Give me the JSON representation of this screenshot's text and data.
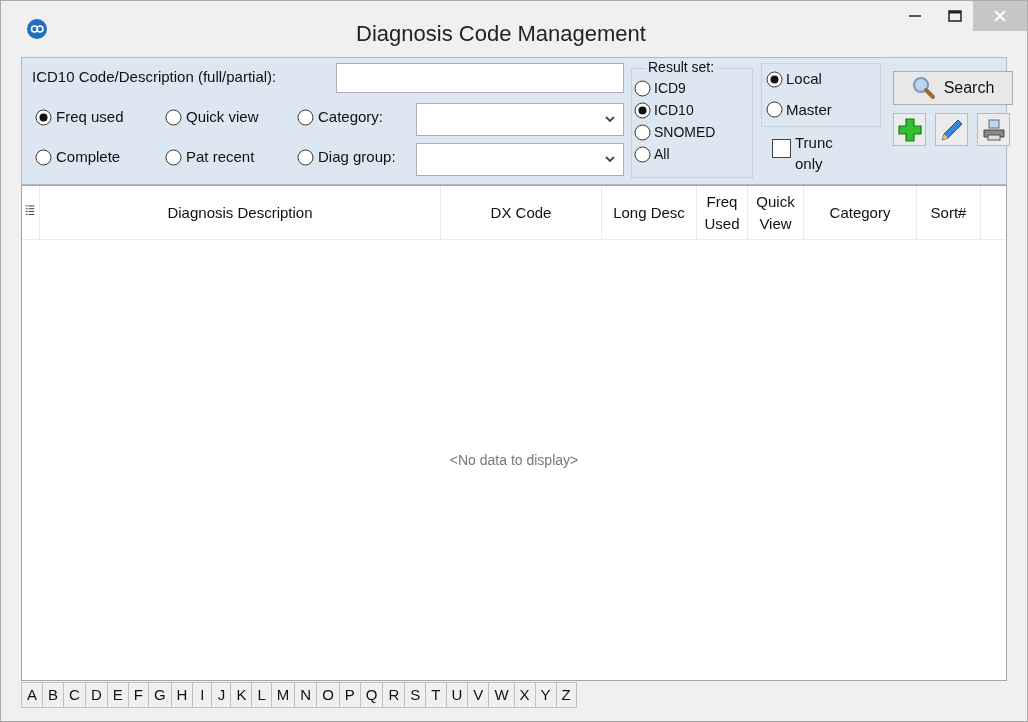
{
  "window": {
    "title": "Diagnosis Code Management"
  },
  "filters": {
    "code_label": "ICD10 Code/Description (full/partial):",
    "modes": [
      {
        "label": "Freq used",
        "selected": true
      },
      {
        "label": "Quick view",
        "selected": false
      },
      {
        "label": "Category:",
        "selected": false
      },
      {
        "label": "Complete",
        "selected": false
      },
      {
        "label": "Pat recent",
        "selected": false
      },
      {
        "label": "Diag group:",
        "selected": false
      }
    ],
    "result_set": {
      "title": "Result set:",
      "options": [
        {
          "label": "ICD9",
          "selected": false
        },
        {
          "label": "ICD10",
          "selected": true
        },
        {
          "label": "SNOMED",
          "selected": false
        },
        {
          "label": "All",
          "selected": false
        }
      ]
    },
    "source": [
      {
        "label": "Local",
        "selected": true
      },
      {
        "label": "Master",
        "selected": false
      }
    ],
    "trunc_only": {
      "label": "Trunc only",
      "checked": false
    },
    "search_button": {
      "label": "Search"
    }
  },
  "table": {
    "columns": [
      "Diagnosis Description",
      "DX Code",
      "Long Desc",
      "Freq Used",
      "Quick View",
      "Category",
      "Sort#"
    ],
    "empty_text": "<No data to display>"
  },
  "alphabet": [
    "A",
    "B",
    "C",
    "D",
    "E",
    "F",
    "G",
    "H",
    "I",
    "J",
    "K",
    "L",
    "M",
    "N",
    "O",
    "P",
    "Q",
    "R",
    "S",
    "T",
    "U",
    "V",
    "W",
    "X",
    "Y",
    "Z"
  ]
}
